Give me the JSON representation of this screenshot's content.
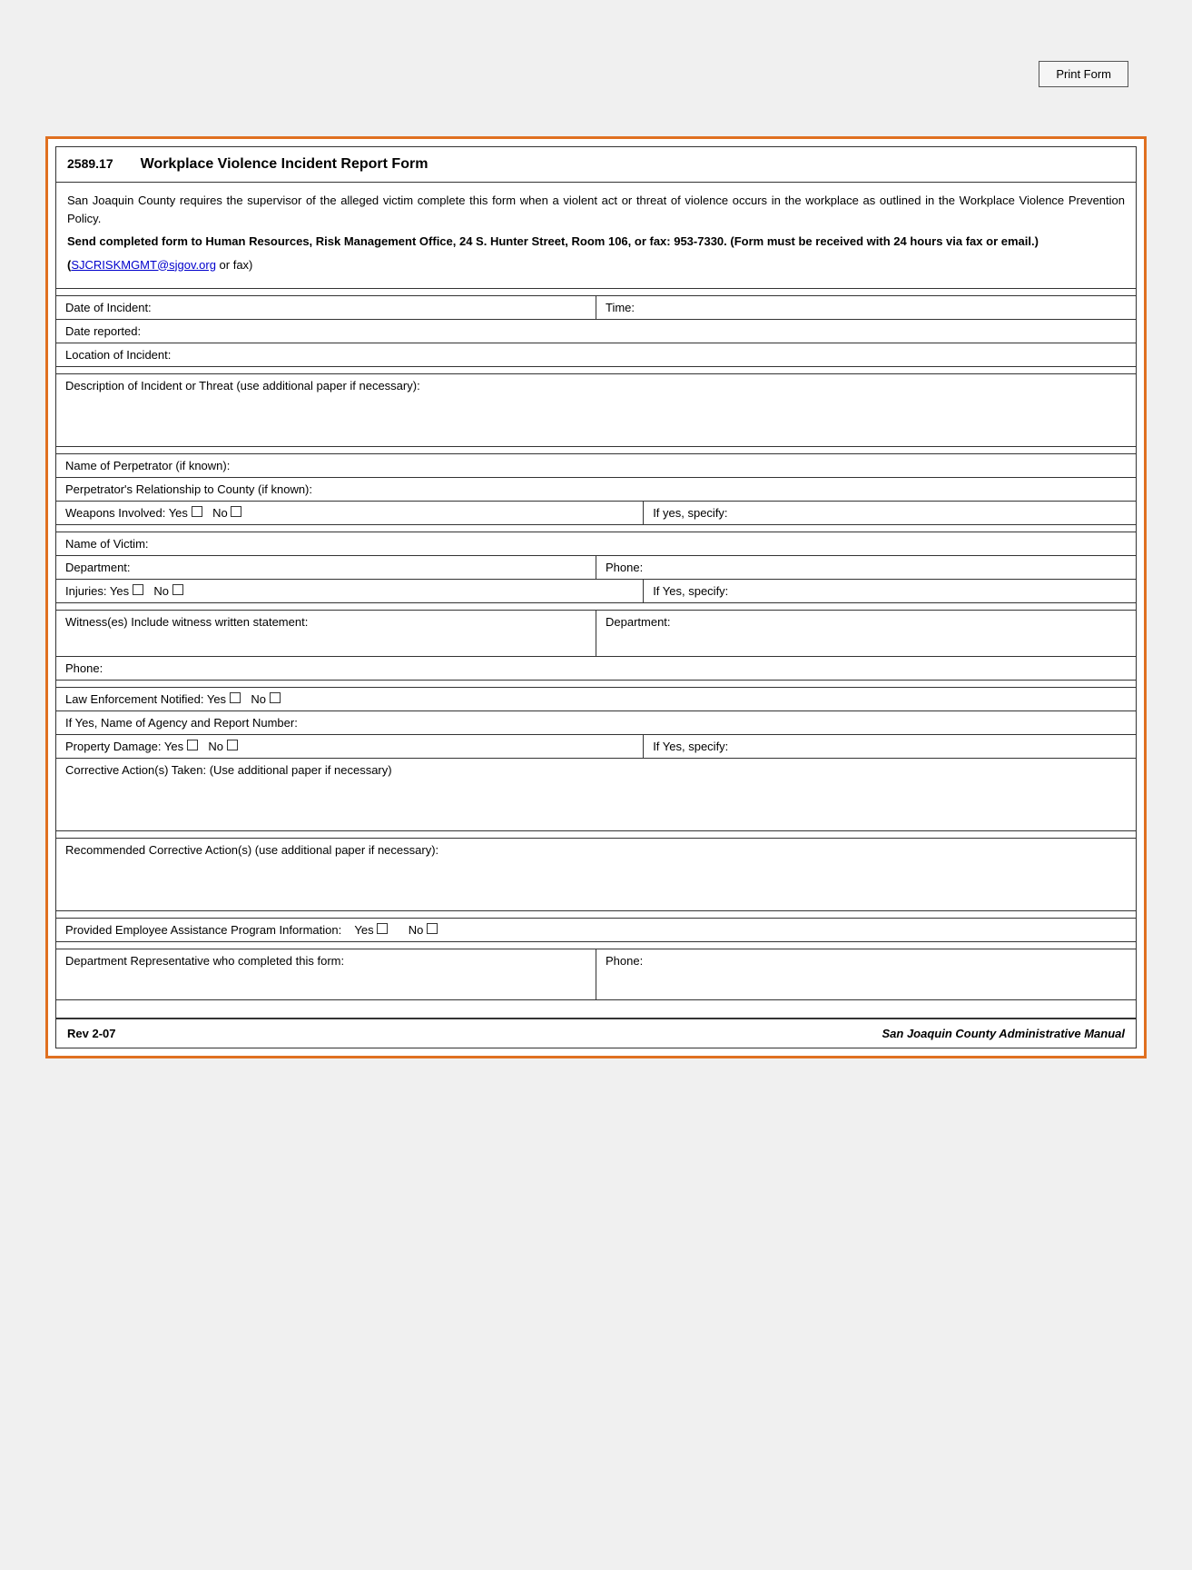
{
  "page": {
    "background_color": "#f0f0f0"
  },
  "print_button": {
    "label": "Print Form"
  },
  "form": {
    "number": "2589.17",
    "title": "Workplace Violence Incident Report Form",
    "intro_paragraph": "San Joaquin County requires the supervisor of the alleged victim complete this form when a violent act or threat of violence occurs in the workplace as outlined in the Workplace Violence Prevention Policy.",
    "send_instructions_bold": "Send completed form to Human Resources, Risk Management Office, 24 S. Hunter Street, Room 106, or fax: 953-7330. (Form must be received with 24 hours via fax or email.)",
    "email_link": "SJCRISKMGMT@sjgov.org",
    "email_suffix": " or fax)",
    "fields": {
      "date_of_incident_label": "Date of Incident:",
      "time_label": "Time:",
      "date_reported_label": "Date reported:",
      "location_label": "Location of Incident:",
      "description_label": "Description of Incident or Threat (use additional paper if necessary):",
      "perpetrator_name_label": "Name of Perpetrator (if known):",
      "perpetrator_relationship_label": "Perpetrator's Relationship to County (if known):",
      "weapons_label": "Weapons Involved: Yes",
      "weapons_no_label": "No",
      "weapons_specify_label": "If yes, specify:",
      "victim_name_label": "Name of Victim:",
      "department_label": "Department:",
      "phone_label": "Phone:",
      "injuries_label": "Injuries: Yes",
      "injuries_no_label": "No",
      "injuries_specify_label": "If Yes, specify:",
      "witness_label": "Witness(es) Include witness written statement:",
      "witness_dept_label": "Department:",
      "witness_phone_label": "Phone:",
      "law_enforcement_label": "Law Enforcement Notified: Yes",
      "law_enforcement_no_label": "No",
      "agency_label": "If Yes, Name of Agency and Report Number:",
      "property_damage_label": "Property Damage: Yes",
      "property_damage_no_label": "No",
      "property_damage_specify_label": "If Yes, specify:",
      "corrective_action_label": "Corrective Action(s) Taken: (Use additional paper if necessary)",
      "recommended_corrective_label": "Recommended Corrective Action(s) (use additional paper if necessary):",
      "employee_assistance_label": "Provided Employee Assistance Program Information:",
      "employee_assistance_yes": "Yes",
      "employee_assistance_no": "No",
      "dept_rep_label": "Department Representative who completed this form:",
      "dept_rep_phone_label": "Phone:"
    },
    "footer": {
      "rev": "Rev 2-07",
      "manual": "San Joaquin County Administrative Manual"
    }
  }
}
